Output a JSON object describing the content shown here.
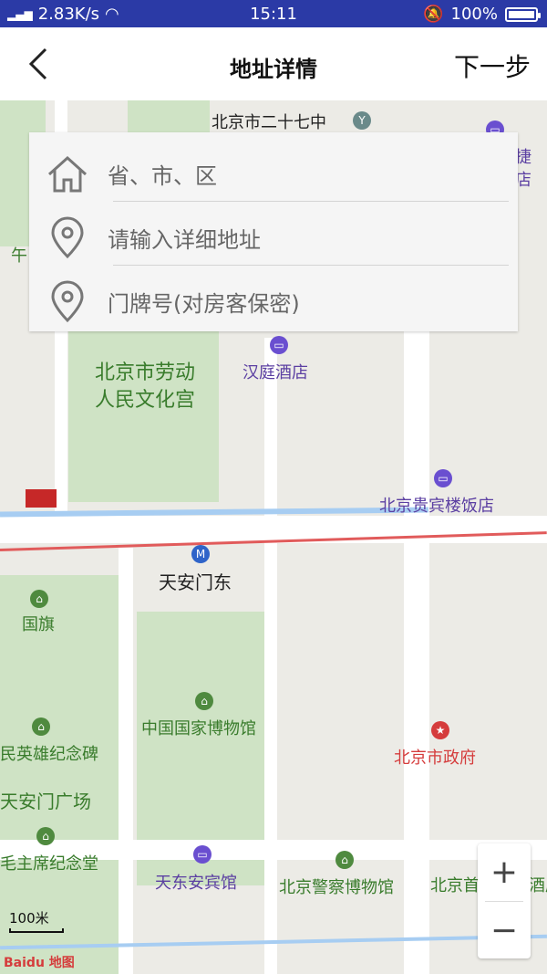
{
  "status_bar": {
    "network": "2.83K/s",
    "time": "15:11",
    "battery": "100%",
    "battery_level": 1.0
  },
  "header": {
    "title": "地址详情",
    "next_label": "下一步"
  },
  "address_form": {
    "region": {
      "placeholder": "省、市、区",
      "icon": "home-icon"
    },
    "detail": {
      "placeholder": "请输入详细地址",
      "icon": "location-pin-icon"
    },
    "house_no": {
      "placeholder": "门牌号(对房客保密)",
      "icon": "location-pin-icon"
    }
  },
  "map": {
    "labels": {
      "l1": "北京市二十七中",
      "l2": "捷",
      "l3": "店",
      "l4": "午",
      "l5": "北京市劳动",
      "l6": "人民文化宫",
      "l7": "汉庭酒店",
      "l8": "北京贵宾楼饭店",
      "l9": "天安门东",
      "l10": "国旗",
      "l11": "中国国家博物馆",
      "l12": "民英雄纪念碑",
      "l13": "北京市政府",
      "l14": "天安门广场",
      "l15": "毛主席纪念堂",
      "l16": "天东安宾馆",
      "l17": "北京警察博物馆",
      "l18": "北京首",
      "l19": "酒店"
    },
    "scale": "100米",
    "logo": "Baidu 地图",
    "zoom_in": "+",
    "zoom_out": "−"
  },
  "colors": {
    "status_bar": "#2b3aa6",
    "metro_line": "#e15b5b",
    "water": "#a7cdf2",
    "park": "#cfe3c5"
  }
}
